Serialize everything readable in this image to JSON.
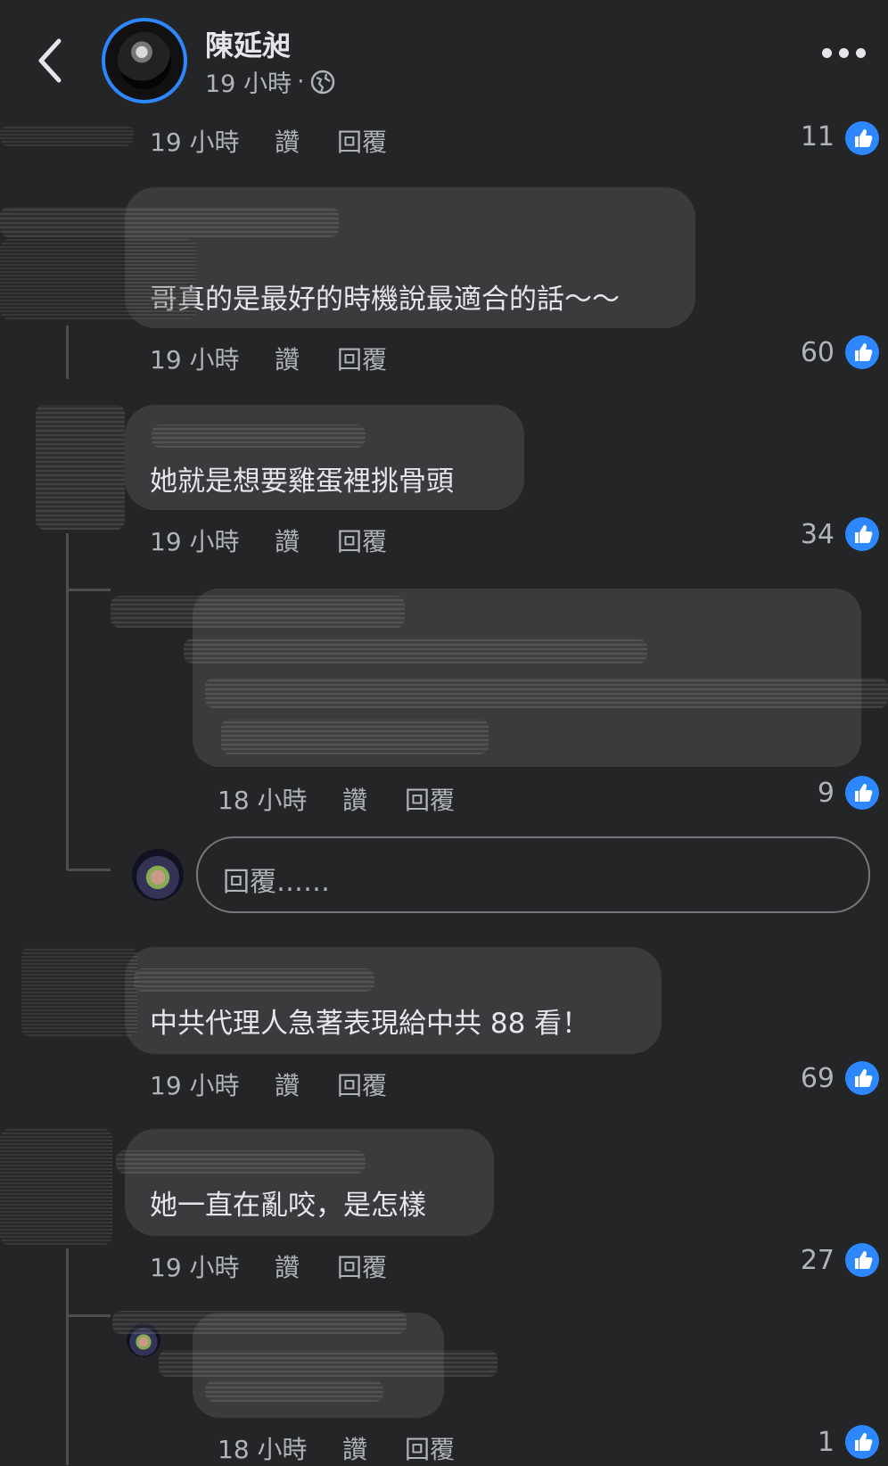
{
  "header": {
    "author_name": "陳延昶",
    "post_time": "19 小時",
    "dot": "·"
  },
  "actions": {
    "like": "讚",
    "reply": "回覆"
  },
  "comments": [
    {
      "time": "19 小時",
      "likes": "11"
    },
    {
      "text": "哥真的是最好的時機說最適合的話～～",
      "time": "19 小時",
      "likes": "60"
    },
    {
      "text": "她就是想要雞蛋裡挑骨頭",
      "time": "19 小時",
      "likes": "34"
    },
    {
      "time": "18 小時",
      "likes": "9"
    },
    {
      "text": "中共代理人急著表現給中共 88 看！",
      "time": "19 小時",
      "likes": "69"
    },
    {
      "text": "她一直在亂咬，是怎樣",
      "time": "19 小時",
      "likes": "27"
    },
    {
      "time": "18 小時",
      "likes": "1"
    }
  ],
  "reply_input": {
    "placeholder": "回覆……"
  },
  "colors": {
    "background": "#242526",
    "bubble": "#3a3b3c",
    "accent": "#2d88ff"
  }
}
